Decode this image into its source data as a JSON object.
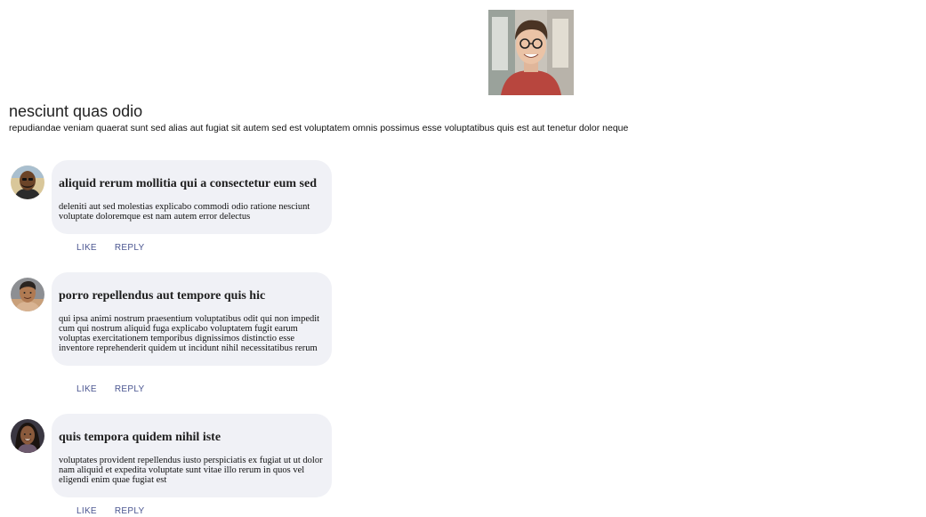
{
  "post": {
    "photo_icon": "profile-photo",
    "title": "nesciunt quas odio",
    "body": "repudiandae veniam quaerat sunt sed alias aut fugiat sit autem sed est voluptatem omnis possimus esse voluptatibus quis est aut tenetur dolor neque"
  },
  "comments": [
    {
      "title": "aliquid rerum mollitia qui a consectetur eum sed",
      "body": "deleniti aut sed molestias explicabo commodi odio ratione nesciunt voluptate doloremque est nam autem error delectus",
      "like_label": "LIKE",
      "reply_label": "REPLY"
    },
    {
      "title": "porro repellendus aut tempore quis hic",
      "body": "qui ipsa animi nostrum praesentium voluptatibus odit qui non impedit cum qui nostrum aliquid fuga explicabo voluptatem fugit earum voluptas exercitationem temporibus dignissimos distinctio esse inventore reprehenderit quidem ut incidunt nihil necessitatibus rerum",
      "like_label": "LIKE",
      "reply_label": "REPLY"
    },
    {
      "title": "quis tempora quidem nihil iste",
      "body": "voluptates provident repellendus iusto perspiciatis ex fugiat ut ut dolor nam aliquid et expedita voluptate sunt vitae illo rerum in quos vel eligendi enim quae fugiat est",
      "like_label": "LIKE",
      "reply_label": "REPLY"
    }
  ],
  "colors": {
    "bubble": "#f0f1f6",
    "action_link": "#4a5590"
  }
}
